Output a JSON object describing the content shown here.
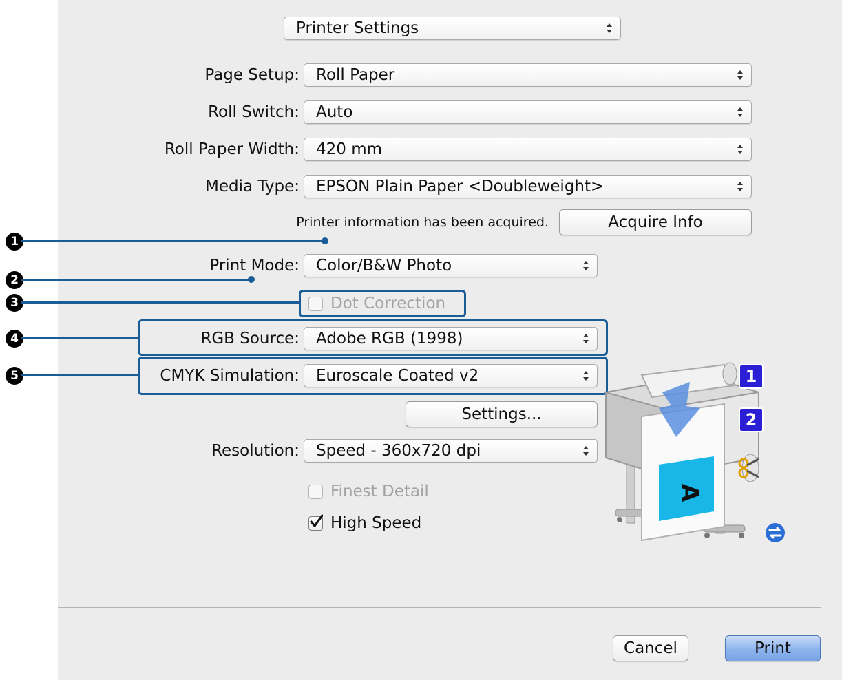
{
  "panel_selector": {
    "value": "Printer Settings"
  },
  "fields": {
    "page_setup": {
      "label": "Page Setup:",
      "value": "Roll Paper"
    },
    "roll_switch": {
      "label": "Roll Switch:",
      "value": "Auto"
    },
    "roll_paper_width": {
      "label": "Roll Paper Width:",
      "value": "420 mm"
    },
    "media_type": {
      "label": "Media Type:",
      "value": "EPSON Plain Paper <Doubleweight>"
    },
    "print_mode": {
      "label": "Print Mode:",
      "value": "Color/B&W Photo"
    },
    "rgb_source": {
      "label": "RGB Source:",
      "value": "Adobe RGB (1998)"
    },
    "cmyk_simulation": {
      "label": "CMYK Simulation:",
      "value": "Euroscale Coated v2"
    },
    "resolution": {
      "label": "Resolution:",
      "value": "Speed - 360x720 dpi"
    }
  },
  "printer_info": {
    "status_text": "Printer information has been acquired.",
    "acquire_button": "Acquire Info"
  },
  "checkboxes": {
    "dot_correction": {
      "label": "Dot Correction",
      "checked": false,
      "enabled": false
    },
    "finest_detail": {
      "label": "Finest Detail",
      "checked": false,
      "enabled": false
    },
    "high_speed": {
      "label": "High Speed",
      "checked": true,
      "enabled": true
    }
  },
  "settings_button": "Settings...",
  "footer": {
    "cancel": "Cancel",
    "print": "Print"
  },
  "callouts": [
    "1",
    "2",
    "3",
    "4",
    "5"
  ],
  "illustration": {
    "roll_badge_1": "1",
    "roll_badge_2": "2",
    "paper_letter": "A"
  },
  "colors": {
    "callout_blue": "#1a5c96",
    "badge_purple": "#2b1fd6",
    "paper_cyan": "#19b7e8"
  }
}
